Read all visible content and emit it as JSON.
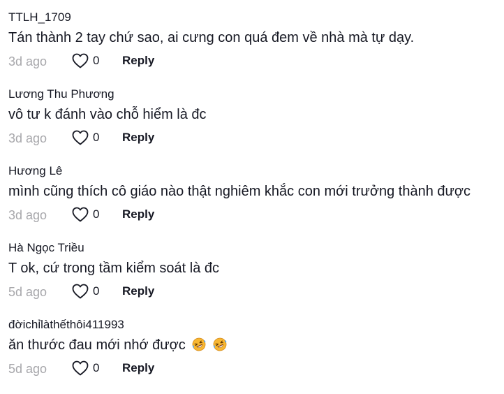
{
  "comments": [
    {
      "username": "TTLH_1709",
      "text": "Tán thành 2 tay chứ sao, ai cưng con quá đem về nhà mà tự dạy.",
      "time": "3d ago",
      "likes": "0",
      "reply_label": "Reply"
    },
    {
      "username": "Lương Thu Phương",
      "text": "vô tư k đánh vào chỗ hiểm là đc",
      "time": "3d ago",
      "likes": "0",
      "reply_label": "Reply"
    },
    {
      "username": "Hương Lê",
      "text": "mình cũng thích cô giáo nào thật nghiêm khắc con mới trưởng thành được",
      "time": "3d ago",
      "likes": "0",
      "reply_label": "Reply"
    },
    {
      "username": "Hà Ngọc Triều",
      "text": "T ok, cứ trong tầm kiểm soát là đc",
      "time": "5d ago",
      "likes": "0",
      "reply_label": "Reply"
    },
    {
      "username": "đờichỉlàthếthôi411993",
      "text": "ăn thước đau mới nhớ được",
      "time": "5d ago",
      "likes": "0",
      "reply_label": "Reply",
      "emojis": [
        "rolling-on-floor-laughing-emoji",
        "rolling-on-floor-laughing-emoji"
      ]
    }
  ],
  "colors": {
    "text": "#161823",
    "muted": "#a7a7ab",
    "heart_stroke": "#161823",
    "emoji_face": "#f7b733",
    "emoji_tear": "#4aa8ff"
  }
}
